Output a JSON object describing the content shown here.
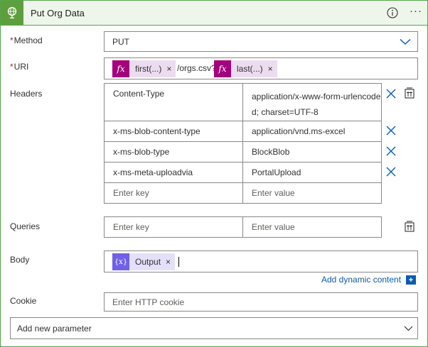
{
  "card": {
    "title": "Put Org Data",
    "icon": "globe-icon",
    "accent_color": "#5e9f3d"
  },
  "method": {
    "label": "Method",
    "required_mark": "*",
    "value": "PUT"
  },
  "uri": {
    "label": "URI",
    "required_mark": "*",
    "token1": {
      "icon": "fx",
      "label": "first(...)",
      "remove": "×"
    },
    "literal": "/orgs.csv?",
    "token2": {
      "icon": "fx",
      "label": "last(...)",
      "remove": "×"
    }
  },
  "headers": {
    "label": "Headers",
    "rows": [
      {
        "key": "Content-Type",
        "value": "application/x-www-form-urlencoded; charset=UTF-8"
      },
      {
        "key": "x-ms-blob-content-type",
        "value": "application/vnd.ms-excel"
      },
      {
        "key": "x-ms-blob-type",
        "value": "BlockBlob"
      },
      {
        "key": "x-ms-meta-uploadvia",
        "value": "PortalUpload"
      }
    ],
    "key_placeholder": "Enter key",
    "value_placeholder": "Enter value"
  },
  "queries": {
    "label": "Queries",
    "key_placeholder": "Enter key",
    "value_placeholder": "Enter value"
  },
  "body": {
    "label": "Body",
    "token": {
      "icon": "{x}",
      "label": "Output",
      "remove": "×"
    },
    "add_dynamic": "Add dynamic content",
    "add_dynamic_icon": "+"
  },
  "cookie": {
    "label": "Cookie",
    "placeholder": "Enter HTTP cookie"
  },
  "add_param": {
    "label": "Add new parameter"
  },
  "colors": {
    "border_green": "#52a64a",
    "header_bg": "#eef6ec",
    "fx_token": "#a3007d",
    "var_token": "#7160e8",
    "link_blue": "#0b5cad",
    "required_red": "#a4262c"
  }
}
